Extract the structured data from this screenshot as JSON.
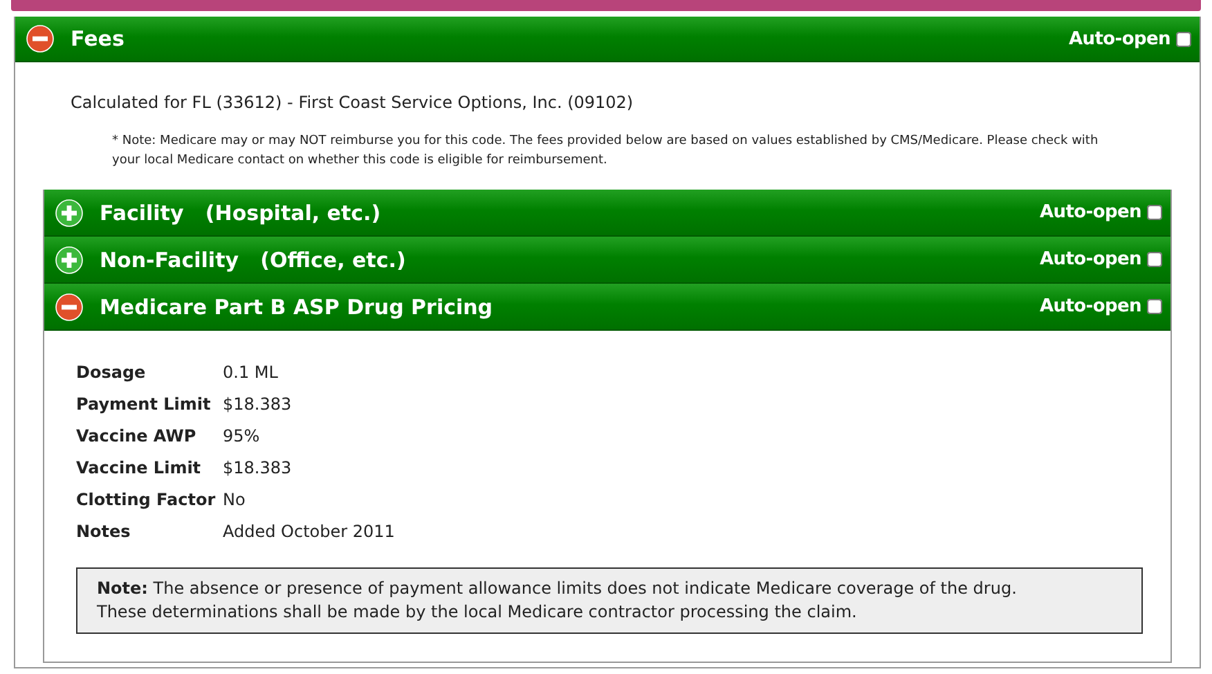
{
  "top_bar": {
    "kind": "collapsed"
  },
  "fees": {
    "title": "Fees",
    "expanded": true,
    "auto_open_label": "Auto-open",
    "auto_open": false,
    "calculated_for": "Calculated for FL (33612) - First Coast Service Options, Inc. (09102)",
    "note": "* Note: Medicare may or may NOT reimburse you for this code. The fees provided below are based on values established by CMS/Medicare. Please check with your local Medicare contact on whether this code is eligible for reimbursement.",
    "sections": [
      {
        "title": "Facility   (Hospital, etc.)",
        "expanded": false,
        "auto_open_label": "Auto-open",
        "auto_open": false
      },
      {
        "title": "Non-Facility   (Office, etc.)",
        "expanded": false,
        "auto_open_label": "Auto-open",
        "auto_open": false
      },
      {
        "title": "Medicare Part B ASP Drug Pricing",
        "expanded": true,
        "auto_open_label": "Auto-open",
        "auto_open": false,
        "fields": [
          {
            "label": "Dosage",
            "value": "0.1 ML"
          },
          {
            "label": "Payment Limit",
            "value": "$18.383"
          },
          {
            "label": "Vaccine AWP",
            "value": "95%"
          },
          {
            "label": "Vaccine Limit",
            "value": "$18.383"
          },
          {
            "label": "Clotting Factor",
            "value": "No"
          },
          {
            "label": "Notes",
            "value": "Added October 2011"
          }
        ],
        "disclaimer": "**Note:** The absence or presence of payment allowance limits does not indicate Medicare coverage of the drug.\nThese determinations shall be made by the local Medicare contractor processing the claim."
      }
    ]
  }
}
